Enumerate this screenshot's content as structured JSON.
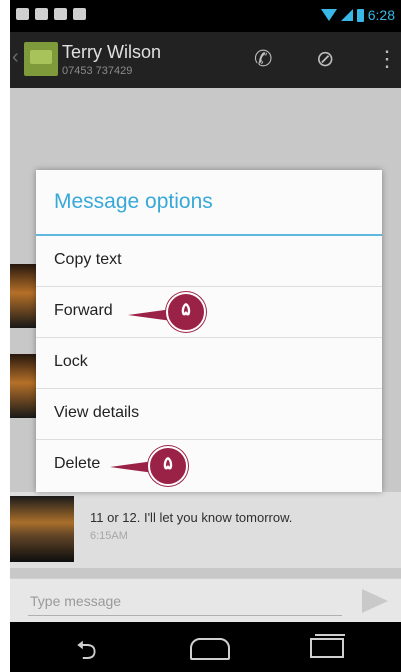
{
  "status_bar": {
    "time": "6:28"
  },
  "header": {
    "contact_name": "Terry Wilson",
    "contact_phone": "07453 737429"
  },
  "dialog": {
    "title": "Message options",
    "options": [
      "Copy text",
      "Forward",
      "Lock",
      "View details",
      "Delete"
    ]
  },
  "message": {
    "text": "11 or 12. I'll let you know tomorrow.",
    "time": "6:15AM"
  },
  "compose": {
    "placeholder": "Type message"
  },
  "callouts": [
    {
      "label": "۵"
    },
    {
      "label": "۵"
    }
  ],
  "colors": {
    "accent": "#37a9d8",
    "pin": "#9b2247",
    "action_bar": "#222222"
  }
}
